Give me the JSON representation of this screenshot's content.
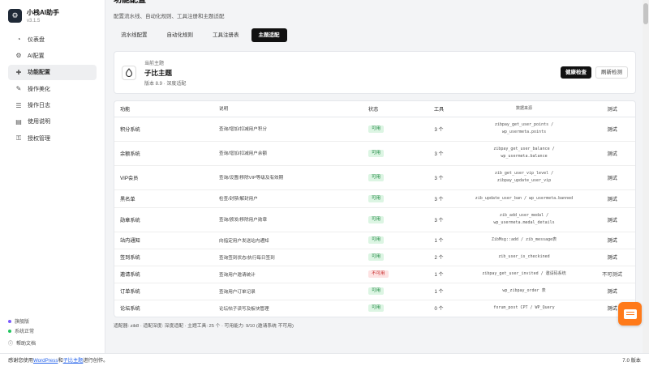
{
  "brand": {
    "name": "小栈AI助手",
    "version": "v3.1.5",
    "logo_icon": "gear-icon"
  },
  "sidebar": {
    "items": [
      {
        "label": "仪表盘",
        "icon": "dashboard-icon",
        "glyph": "◔",
        "active": false
      },
      {
        "label": "AI配置",
        "icon": "gear-icon",
        "glyph": "⚙",
        "active": false
      },
      {
        "label": "功能配置",
        "icon": "puzzle-icon",
        "glyph": "✚",
        "active": true
      },
      {
        "label": "操作美化",
        "icon": "brush-icon",
        "glyph": "✎",
        "active": false
      },
      {
        "label": "操作日志",
        "icon": "list-icon",
        "glyph": "☰",
        "active": false
      },
      {
        "label": "使用说明",
        "icon": "book-icon",
        "glyph": "▤",
        "active": false
      },
      {
        "label": "授权管理",
        "icon": "key-icon",
        "glyph": "⚿",
        "active": false
      }
    ],
    "footer": {
      "status1": "旗舰版",
      "status1_color": "#7c5cff",
      "status2": "系统正常",
      "status2_color": "#22c55e",
      "help": "帮助文档"
    }
  },
  "header": {
    "title": "功能配置",
    "subtitle": "配置流水线、自动化规则、工具注册和主题适配"
  },
  "tabs": [
    {
      "label": "流水线配置",
      "active": false
    },
    {
      "label": "自动化规则",
      "active": false
    },
    {
      "label": "工具注册表",
      "active": false
    },
    {
      "label": "主题适配",
      "active": true
    }
  ],
  "theme": {
    "label": "当前主题",
    "name": "子比主题",
    "meta": "版本 8.9 · 深度适配",
    "health_button": "健康检查",
    "refresh_button": "刷新检测"
  },
  "table": {
    "columns": [
      "功能",
      "说明",
      "状态",
      "工具",
      "数据来源",
      "测试"
    ],
    "rows": [
      {
        "name": "积分系统",
        "desc": "查询/增加/扣减用户积分",
        "status": "可用",
        "ok": true,
        "tools": "3 个",
        "src1": "zibpay_get_user_points /",
        "src2": "wp_usermeta.points",
        "test": "测试"
      },
      {
        "name": "余额系统",
        "desc": "查询/增加/扣减用户余额",
        "status": "可用",
        "ok": true,
        "tools": "3 个",
        "src1": "zibpay_get_user_balance /",
        "src2": "wp_usermeta.balance",
        "test": "测试"
      },
      {
        "name": "VIP会员",
        "desc": "查询/设置/移除VIP等级及有效期",
        "status": "可用",
        "ok": true,
        "tools": "3 个",
        "src1": "zib_get_user_vip_level /",
        "src2": "zibpay_update_user_vip",
        "test": "测试"
      },
      {
        "name": "黑名单",
        "desc": "检查/封禁/解封用户",
        "status": "可用",
        "ok": true,
        "tools": "3 个",
        "src1": "zib_update_user_ban / wp_usermeta.banned",
        "src2": "",
        "test": "测试"
      },
      {
        "name": "勋章系统",
        "desc": "查询/颁发/移除用户勋章",
        "status": "可用",
        "ok": true,
        "tools": "3 个",
        "src1": "zib_add_user_medal /",
        "src2": "wp_usermeta.medal_details",
        "test": "测试"
      },
      {
        "name": "站内通知",
        "desc": "向指定用户发送站内通知",
        "status": "可用",
        "ok": true,
        "tools": "1 个",
        "src1": "ZibMsg::add / zib_message表",
        "src2": "",
        "test": "测试"
      },
      {
        "name": "签到系统",
        "desc": "查询签到状态/执行每日签到",
        "status": "可用",
        "ok": true,
        "tools": "2 个",
        "src1": "zib_user_is_checkined",
        "src2": "",
        "test": "测试"
      },
      {
        "name": "邀请系统",
        "desc": "查询用户邀请统计",
        "status": "不可用",
        "ok": false,
        "tools": "1 个",
        "src1": "zibpay_get_user_invited / 邀请码系统",
        "src2": "",
        "test": "不可测试"
      },
      {
        "name": "订单系统",
        "desc": "查询用户订单记录",
        "status": "可用",
        "ok": true,
        "tools": "1 个",
        "src1": "wp_zibpay_order 表",
        "src2": "",
        "test": "测试"
      },
      {
        "name": "论坛系统",
        "desc": "论坛帖子读写及板块管理",
        "status": "可用",
        "ok": true,
        "tools": "0 个",
        "src1": "forum_post CPT / WP_Query",
        "src2": "",
        "test": "测试"
      }
    ]
  },
  "summary": "适配器: zib8 · 适配深度: 深度适配 · 主题工具: 25 个 · 可用能力: 9/10 (邀请系统 不可用)",
  "footer": {
    "prefix": "感谢您使用",
    "link1": "WordPress",
    "middle": "和",
    "link2": "子比主题",
    "suffix": "进行创作。",
    "version": "7.0 版本"
  },
  "fab": {
    "icon": "chat-icon",
    "color": "#ff7a1a"
  }
}
